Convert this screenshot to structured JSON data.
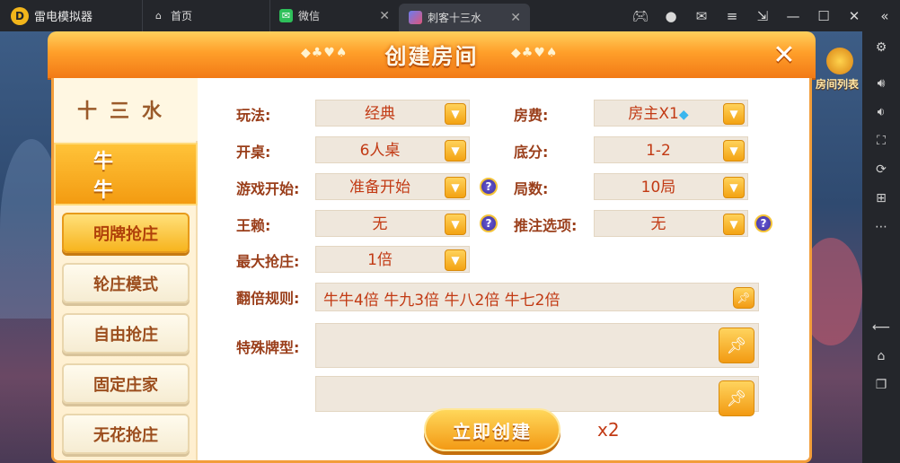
{
  "emulator": {
    "app_name": "雷电模拟器",
    "tabs": [
      {
        "label": "首页",
        "icon": "home-icon"
      },
      {
        "label": "微信",
        "icon": "wechat-icon"
      },
      {
        "label": "刺客十三水",
        "icon": "game-icon",
        "active": true
      }
    ],
    "window_controls": [
      "gamepad-icon",
      "user-icon",
      "mail-icon",
      "menu-icon",
      "restore-icon",
      "minimize-icon",
      "maximize-icon",
      "close-icon",
      "collapse-icon"
    ],
    "sidebar_icons": [
      "settings-icon",
      "volume-up-icon",
      "volume-down-icon",
      "screen-icon",
      "rotate-icon",
      "add-icon",
      "more-icon",
      "back-icon",
      "home-icon",
      "recent-icon"
    ]
  },
  "background": {
    "room_list_label": "房间列表"
  },
  "dialog": {
    "title": "创建房间",
    "deco_left": "◆♣♥♠",
    "deco_right": "◆♣♥♠",
    "game_tabs": [
      "十三水",
      "牛牛"
    ],
    "active_game_tab": 1,
    "modes": [
      {
        "label": "明牌抢庄",
        "selected": true
      },
      {
        "label": "轮庄模式",
        "selected": false
      },
      {
        "label": "自由抢庄",
        "selected": false
      },
      {
        "label": "固定庄家",
        "selected": false
      },
      {
        "label": "无花抢庄",
        "selected": false
      }
    ],
    "options": {
      "play": {
        "label": "玩法:",
        "value": "经典"
      },
      "table": {
        "label": "开桌:",
        "value": "6人桌"
      },
      "start": {
        "label": "游戏开始:",
        "value": "准备开始"
      },
      "wild": {
        "label": "王赖:",
        "value": "无"
      },
      "max_grab": {
        "label": "最大抢庄:",
        "value": "1倍"
      },
      "fee": {
        "label": "房费:",
        "value": "房主X1"
      },
      "base": {
        "label": "底分:",
        "value": "1-2"
      },
      "rounds": {
        "label": "局数:",
        "value": "10局"
      },
      "bet_opt": {
        "label": "推注选项:",
        "value": "无"
      }
    },
    "multiplier_rule": {
      "label": "翻倍规则:",
      "value": "牛牛4倍 牛九3倍 牛八2倍 牛七2倍"
    },
    "special_cards": {
      "label": "特殊牌型:",
      "value": ""
    },
    "create_button": "立即创建",
    "cost": "x2"
  }
}
